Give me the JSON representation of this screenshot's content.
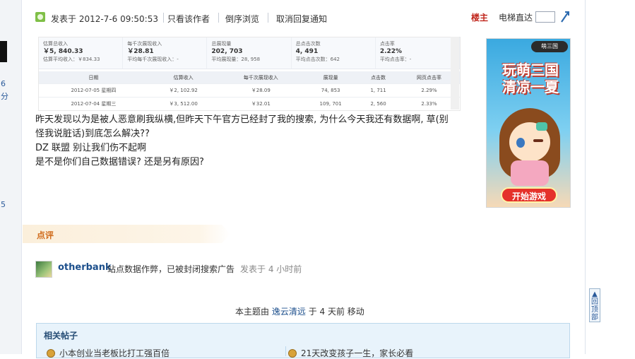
{
  "gutter": {
    "line1": "6",
    "line2": "分",
    "line3": "5"
  },
  "header": {
    "posted_at": "发表于  2012-7-6 09:50:53",
    "only_author": "只看该作者",
    "reverse_view": "倒序浏览",
    "cancel_notify": "取消回复通知",
    "floor": "楼主",
    "elevator": "电梯直达"
  },
  "screenshot": {
    "stats": [
      {
        "label": "估算总收入",
        "value": "￥5, 840.33",
        "sub": "估算平均收入：￥834.33"
      },
      {
        "label": "每千次展现收入",
        "value": "￥28.81",
        "sub": "平均每千次展现收入：-"
      },
      {
        "label": "总展现量",
        "value": "202, 703",
        "sub": "平均展现量：28, 958"
      },
      {
        "label": "总点击次数",
        "value": "4, 491",
        "sub": "平均点击次数：642"
      },
      {
        "label": "点击率",
        "value": "2.22%",
        "sub": "平均点击率：-"
      }
    ],
    "columns": [
      "日期",
      "估算收入",
      "每千次展现收入",
      "展现量",
      "点击数",
      "网页点击率"
    ],
    "rows": [
      [
        "2012-07-05 星期四",
        "￥2, 102.92",
        "￥28.09",
        "74, 853",
        "1, 711",
        "2.29%"
      ],
      [
        "2012-07-04 星期三",
        "￥3, 512.00",
        "￥32.01",
        "109, 701",
        "2, 560",
        "2.33%"
      ]
    ]
  },
  "post": {
    "line1": "昨天发现以为是被人恶意刷我纵横,但昨天下午官方已经封了我的搜索, 为什么今天我还有数据啊, 草(别",
    "line2": "怪我说脏话)到底怎么解决??",
    "line3": "DZ 联盟  别让我们伤不起啊",
    "line4": "是不是你们自己数据错误? 还是另有原因?"
  },
  "ad": {
    "logo": "萌三国",
    "title1": "玩萌三国",
    "title2": "清凉一夏",
    "button": "开始游戏"
  },
  "review": {
    "label": "点评"
  },
  "comment": {
    "user": "otherbank",
    "text": "站点数据作弊，已被封闭搜索广告",
    "time": "发表于  4 小时前"
  },
  "moved": {
    "prefix": "本主题由",
    "user": "逸云清远",
    "middle": "于  4 天前  移动"
  },
  "related": {
    "title": "相关帖子",
    "item1": "小本创业当老板比打工强百倍",
    "item2": "21天改变孩子一生，家长必看"
  },
  "back_top": {
    "label": "回顶部"
  }
}
